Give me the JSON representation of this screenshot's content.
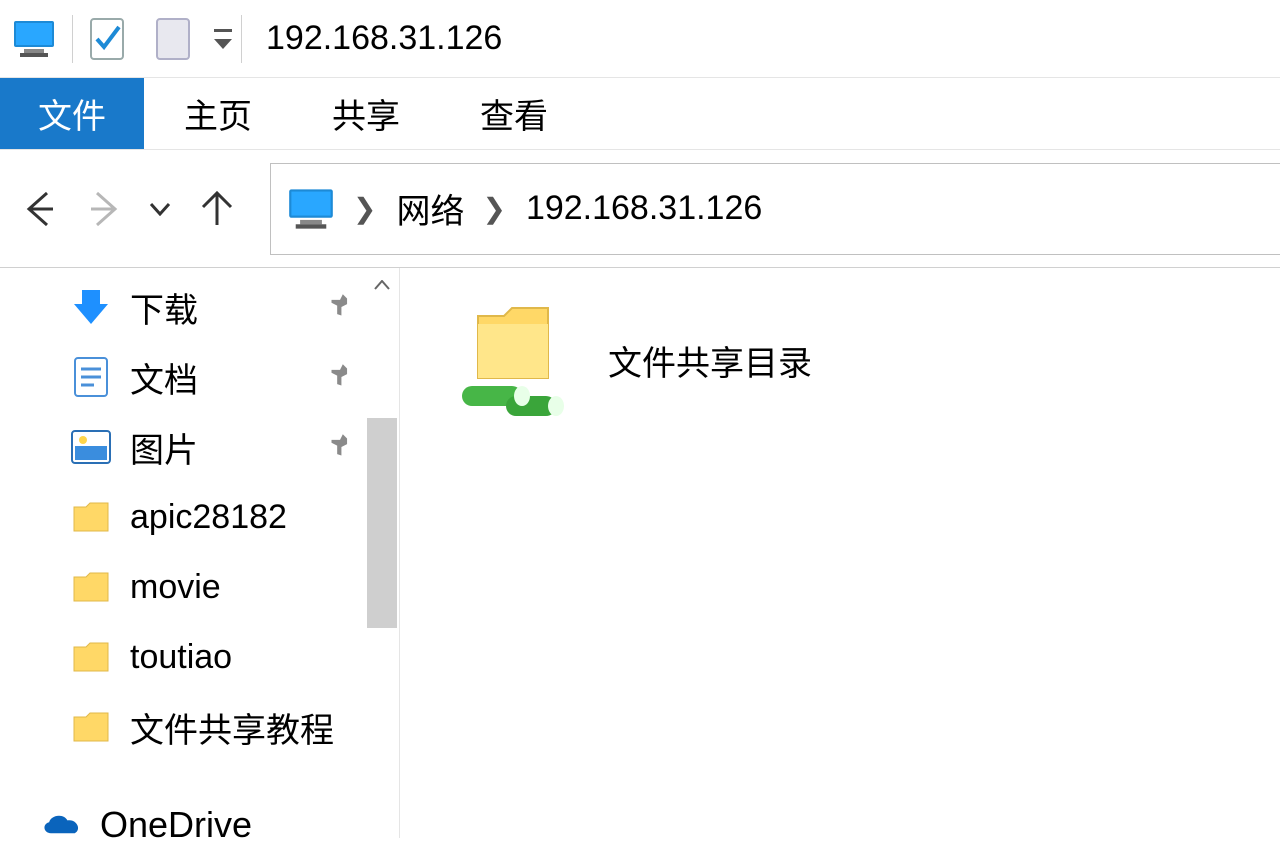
{
  "titlebar": {
    "title": "192.168.31.126"
  },
  "ribbon": {
    "tabs": {
      "file": "文件",
      "home": "主页",
      "share": "共享",
      "view": "查看"
    }
  },
  "breadcrumb": {
    "network": "网络",
    "host": "192.168.31.126"
  },
  "sidebar": {
    "items": [
      {
        "icon": "download",
        "label": "下载",
        "pinned": true
      },
      {
        "icon": "document",
        "label": "文档",
        "pinned": true
      },
      {
        "icon": "pictures",
        "label": "图片",
        "pinned": true
      },
      {
        "icon": "folder",
        "label": "apic28182",
        "pinned": false
      },
      {
        "icon": "folder",
        "label": "movie",
        "pinned": false
      },
      {
        "icon": "folder",
        "label": "toutiao",
        "pinned": false
      },
      {
        "icon": "folder",
        "label": "文件共享教程",
        "pinned": false
      }
    ],
    "onedrive": "OneDrive"
  },
  "content": {
    "share_name": "文件共享目录"
  }
}
